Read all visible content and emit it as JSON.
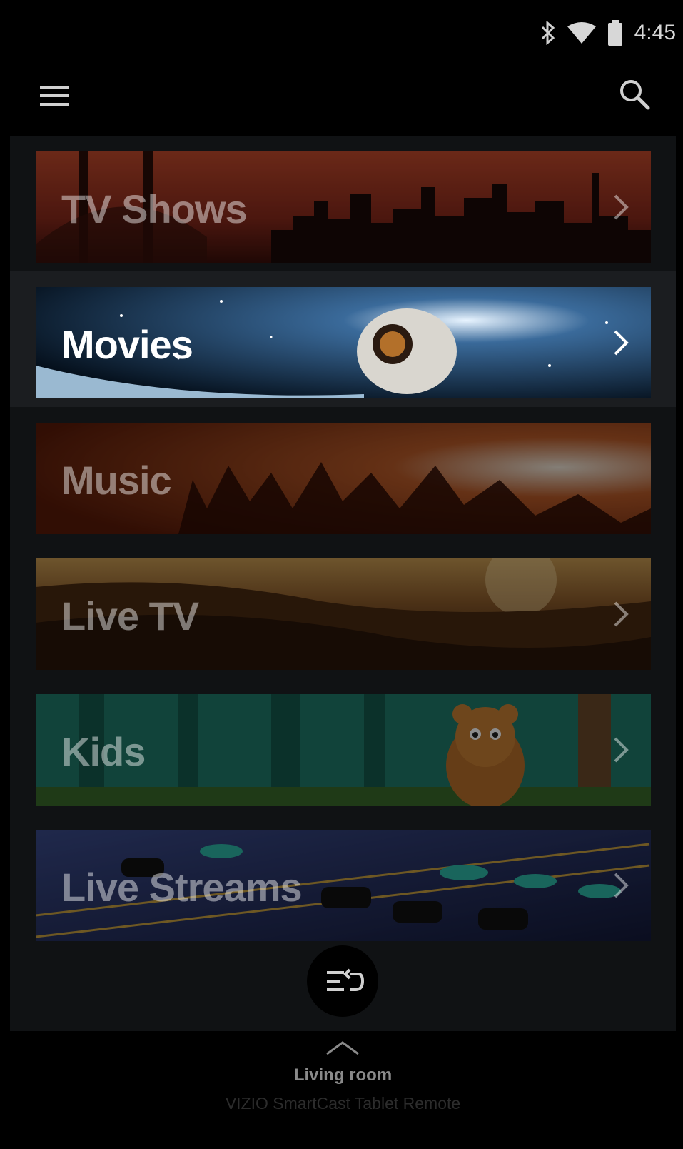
{
  "status_bar": {
    "time": "4:45",
    "icons": [
      "bluetooth-icon",
      "wifi-icon",
      "battery-icon"
    ]
  },
  "app_bar": {
    "menu_icon": "hamburger-menu-icon",
    "search_icon": "search-icon"
  },
  "categories": [
    {
      "label": "TV Shows",
      "selected": false
    },
    {
      "label": "Movies",
      "selected": true
    },
    {
      "label": "Music",
      "selected": false
    },
    {
      "label": "Live TV",
      "selected": false
    },
    {
      "label": "Kids",
      "selected": false
    },
    {
      "label": "Live Streams",
      "selected": false
    }
  ],
  "fab": {
    "icon": "queue-return-icon"
  },
  "footer": {
    "room": "Living room",
    "product": "VIZIO SmartCast Tablet Remote"
  },
  "colors": {
    "background": "#000000",
    "content_background": "#101214",
    "selected_row": "#1b1d20"
  }
}
